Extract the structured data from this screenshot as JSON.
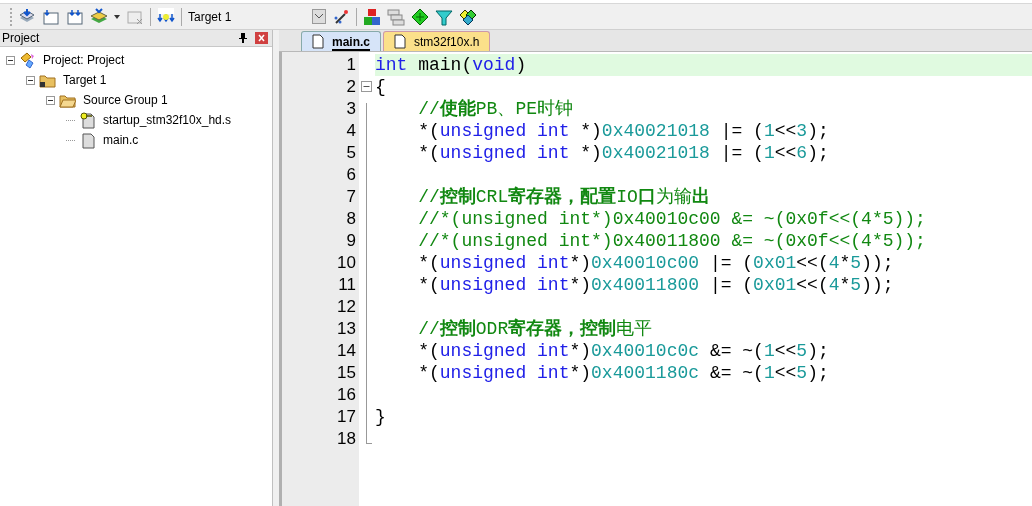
{
  "toolbar": {
    "target": "Target 1"
  },
  "project_panel": {
    "title": "Project",
    "tree": [
      {
        "label": "Project: Project",
        "kind": "project",
        "expanded": true,
        "children": [
          {
            "label": "Target 1",
            "kind": "target",
            "expanded": true,
            "children": [
              {
                "label": "Source Group 1",
                "kind": "group",
                "expanded": true,
                "children": [
                  {
                    "label": "startup_stm32f10x_hd.s",
                    "kind": "asm"
                  },
                  {
                    "label": "main.c",
                    "kind": "file"
                  }
                ]
              }
            ]
          }
        ]
      }
    ]
  },
  "tabs": [
    {
      "label": "main.c",
      "selected": true
    },
    {
      "label": "stm32f10x.h",
      "selected": false
    }
  ],
  "editor": {
    "lines": [
      {
        "number": "1",
        "current": true,
        "indented": false,
        "tokens": [
          {
            "kind": "keyword",
            "text": "int"
          },
          {
            "kind": "plain",
            "text": " main("
          },
          {
            "kind": "keyword",
            "text": "void"
          },
          {
            "kind": "plain",
            "text": ")"
          }
        ]
      },
      {
        "number": "2",
        "current": false,
        "folded": false,
        "indented": false,
        "tokens": [
          {
            "kind": "plain",
            "text": "{"
          }
        ]
      },
      {
        "number": "3",
        "current": false,
        "indented": true,
        "tokens": [
          {
            "kind": "rich_comment",
            "text": "//**使能**PB、PE时钟"
          }
        ]
      },
      {
        "number": "4",
        "current": false,
        "indented": true,
        "tokens": [
          {
            "kind": "plain",
            "text": "*("
          },
          {
            "kind": "keyword",
            "text": "unsigned int"
          },
          {
            "kind": "plain",
            "text": " *)"
          },
          {
            "kind": "number",
            "text": "0x40021018"
          },
          {
            "kind": "plain",
            "text": " |= ("
          },
          {
            "kind": "number",
            "text": "1"
          },
          {
            "kind": "plain",
            "text": "<<"
          },
          {
            "kind": "number",
            "text": "3"
          },
          {
            "kind": "plain",
            "text": ");"
          }
        ]
      },
      {
        "number": "5",
        "current": false,
        "indented": true,
        "tokens": [
          {
            "kind": "plain",
            "text": "*("
          },
          {
            "kind": "keyword",
            "text": "unsigned int"
          },
          {
            "kind": "plain",
            "text": " *)"
          },
          {
            "kind": "number",
            "text": "0x40021018"
          },
          {
            "kind": "plain",
            "text": " |= ("
          },
          {
            "kind": "number",
            "text": "1"
          },
          {
            "kind": "plain",
            "text": "<<"
          },
          {
            "kind": "number",
            "text": "6"
          },
          {
            "kind": "plain",
            "text": ");"
          }
        ]
      },
      {
        "number": "6"
      },
      {
        "number": "7",
        "current": false,
        "indented": true,
        "tokens": [
          {
            "kind": "rich_comment",
            "text": "//**控制**CRL**寄存器，配置**IO**口**为输**出**"
          }
        ]
      },
      {
        "number": "8",
        "current": false,
        "indented": true,
        "tokens": [
          {
            "kind": "comment",
            "text": "//*(unsigned int*)0x40010c00 &= ~(0x0f<<(4*5));"
          }
        ]
      },
      {
        "number": "9",
        "current": false,
        "indented": true,
        "tokens": [
          {
            "kind": "comment",
            "text": "//*(unsigned int*)0x40011800 &= ~(0x0f<<(4*5));"
          }
        ]
      },
      {
        "number": "10",
        "current": false,
        "indented": true,
        "tokens": [
          {
            "kind": "plain",
            "text": "*("
          },
          {
            "kind": "keyword",
            "text": "unsigned int"
          },
          {
            "kind": "plain",
            "text": "*)"
          },
          {
            "kind": "number",
            "text": "0x40010c00"
          },
          {
            "kind": "plain",
            "text": " |= ("
          },
          {
            "kind": "number",
            "text": "0x01"
          },
          {
            "kind": "plain",
            "text": "<<("
          },
          {
            "kind": "number",
            "text": "4"
          },
          {
            "kind": "plain",
            "text": "*"
          },
          {
            "kind": "number",
            "text": "5"
          },
          {
            "kind": "plain",
            "text": "));"
          }
        ]
      },
      {
        "number": "11",
        "current": false,
        "indented": true,
        "tokens": [
          {
            "kind": "plain",
            "text": "*("
          },
          {
            "kind": "keyword",
            "text": "unsigned int"
          },
          {
            "kind": "plain",
            "text": "*)"
          },
          {
            "kind": "number",
            "text": "0x40011800"
          },
          {
            "kind": "plain",
            "text": " |= ("
          },
          {
            "kind": "number",
            "text": "0x01"
          },
          {
            "kind": "plain",
            "text": "<<("
          },
          {
            "kind": "number",
            "text": "4"
          },
          {
            "kind": "plain",
            "text": "*"
          },
          {
            "kind": "number",
            "text": "5"
          },
          {
            "kind": "plain",
            "text": "));"
          }
        ]
      },
      {
        "number": "12"
      },
      {
        "number": "13",
        "current": false,
        "indented": true,
        "tokens": [
          {
            "kind": "rich_comment",
            "text": "//**控制**ODR**寄存器，控制**电平"
          }
        ]
      },
      {
        "number": "14",
        "current": false,
        "indented": true,
        "tokens": [
          {
            "kind": "plain",
            "text": "*("
          },
          {
            "kind": "keyword",
            "text": "unsigned int"
          },
          {
            "kind": "plain",
            "text": "*)"
          },
          {
            "kind": "number",
            "text": "0x40010c0c"
          },
          {
            "kind": "plain",
            "text": " &= ~("
          },
          {
            "kind": "number",
            "text": "1"
          },
          {
            "kind": "plain",
            "text": "<<"
          },
          {
            "kind": "number",
            "text": "5"
          },
          {
            "kind": "plain",
            "text": ");"
          }
        ]
      },
      {
        "number": "15",
        "current": false,
        "indented": true,
        "tokens": [
          {
            "kind": "plain",
            "text": "*("
          },
          {
            "kind": "keyword",
            "text": "unsigned int"
          },
          {
            "kind": "plain",
            "text": "*)"
          },
          {
            "kind": "number",
            "text": "0x4001180c"
          },
          {
            "kind": "plain",
            "text": " &= ~("
          },
          {
            "kind": "number",
            "text": "1"
          },
          {
            "kind": "plain",
            "text": "<<"
          },
          {
            "kind": "number",
            "text": "5"
          },
          {
            "kind": "plain",
            "text": ");"
          }
        ]
      },
      {
        "number": "16"
      },
      {
        "number": "17",
        "current": false,
        "indented": false,
        "tokens": [
          {
            "kind": "plain",
            "text": "}"
          }
        ]
      },
      {
        "number": "18"
      }
    ]
  }
}
